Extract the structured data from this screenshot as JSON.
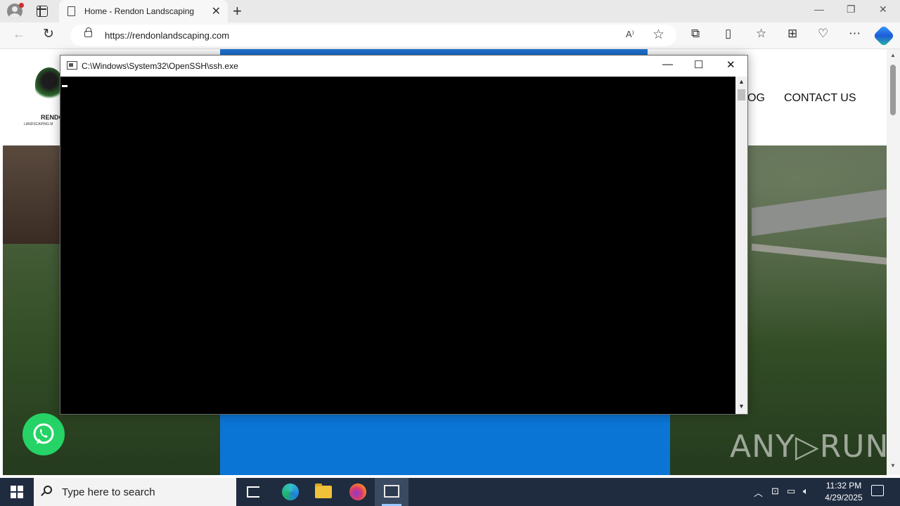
{
  "browser": {
    "tab_title": "Home - Rendon Landscaping",
    "tab_close": "✕",
    "new_tab": "+",
    "url": "https://rendonlandscaping.com",
    "read_aloud": "A⁾",
    "window_controls": {
      "minimize": "—",
      "restore": "❐",
      "close": "✕"
    }
  },
  "website": {
    "logo_name": "RENDON",
    "logo_tagline": "LANDSCAPING M",
    "nav_partial": "OG",
    "nav_contact": "CONTACT US"
  },
  "console": {
    "title": "C:\\Windows\\System32\\OpenSSH\\ssh.exe",
    "controls": {
      "minimize": "—",
      "maximize": "☐",
      "close": "✕"
    }
  },
  "watermark": "ANY▷RUN",
  "taskbar": {
    "search_placeholder": "Type here to search",
    "time": "11:32 PM",
    "date": "4/29/2025"
  },
  "colors": {
    "popup_blue": "#0b75d6",
    "whatsapp_green": "#25d366",
    "taskbar": "#1f2c3f"
  },
  "icons": [
    "profile-icon",
    "tabs-icon",
    "page-icon",
    "back-icon",
    "reload-icon",
    "lock-icon",
    "read-aloud-icon",
    "favorite-icon",
    "extensions-icon",
    "split-screen-icon",
    "favorites-icon",
    "collections-icon",
    "performance-icon",
    "more-icon",
    "copilot-icon",
    "whatsapp-icon",
    "windows-start-icon",
    "search-icon",
    "task-view-icon",
    "edge-icon",
    "file-explorer-icon",
    "firefox-icon",
    "console-app-icon",
    "chevron-up-icon",
    "network-icon",
    "volume-icon",
    "notification-icon"
  ]
}
